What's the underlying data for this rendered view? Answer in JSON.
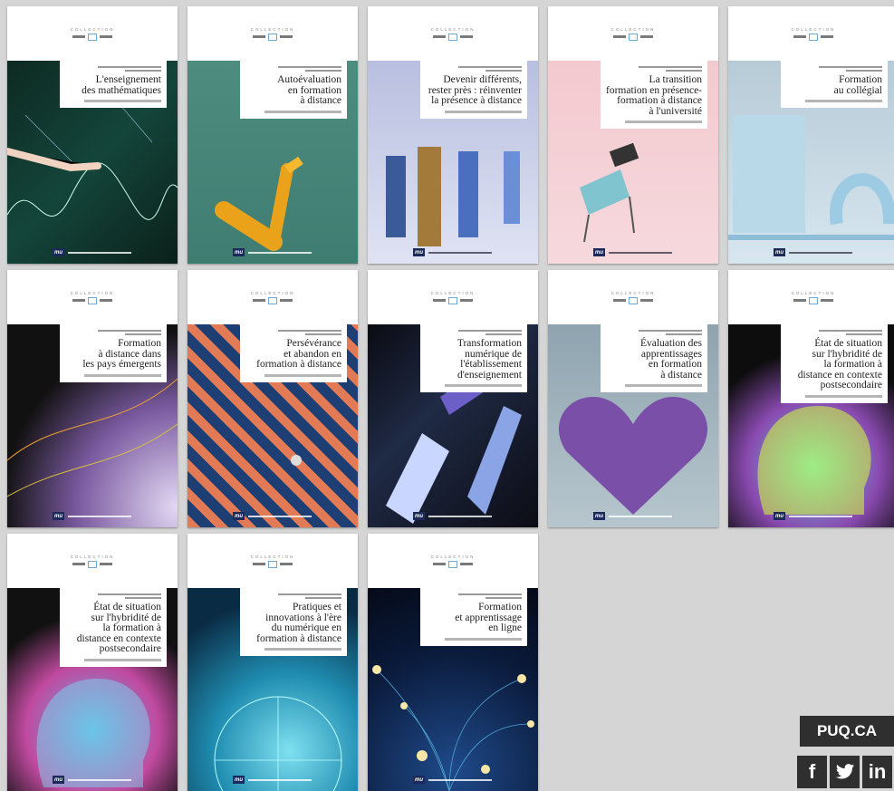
{
  "books": [
    {
      "title": "L'enseignement\ndes mathématiques",
      "art": "math"
    },
    {
      "title": "Autoévaluation\nen formation\nà distance",
      "art": "autoeval"
    },
    {
      "title": "Devenir différents,\nrester près : réinventer\nla présence à distance",
      "art": "devenir"
    },
    {
      "title": "La transition\nformation en présence-\nformation à distance\nà l'université",
      "art": "transition"
    },
    {
      "title": "Formation\nau collégial",
      "art": "collegial"
    },
    {
      "title": "Formation\nà distance dans\nles pays émergents",
      "art": "pays"
    },
    {
      "title": "Persévérance\net abandon en\nformation à distance",
      "art": "perseverance"
    },
    {
      "title": "Transformation\nnumérique de\nl'établissement\nd'enseignement",
      "art": "transformation"
    },
    {
      "title": "Évaluation des\napprentissages\nen formation\nà distance",
      "art": "evaluation"
    },
    {
      "title": "État de situation\nsur l'hybridité de\nla formation à\ndistance en contexte\npostsecondaire",
      "art": "etat1"
    },
    {
      "title": "État de situation\nsur l'hybridité de\nla formation à\ndistance en contexte\npostsecondaire",
      "art": "etat2"
    },
    {
      "title": "Pratiques et\ninnovations à l'ère\ndu numérique en\nformation à distance",
      "art": "pratiques"
    },
    {
      "title": "Formation\net apprentissage\nen ligne",
      "art": "enligne"
    }
  ],
  "publisher_logo": "mu",
  "collection_label": "COLLECTION",
  "site": "PUQ.CA",
  "social": {
    "facebook": "f",
    "twitter": "twitter-bird",
    "linkedin": "in"
  }
}
